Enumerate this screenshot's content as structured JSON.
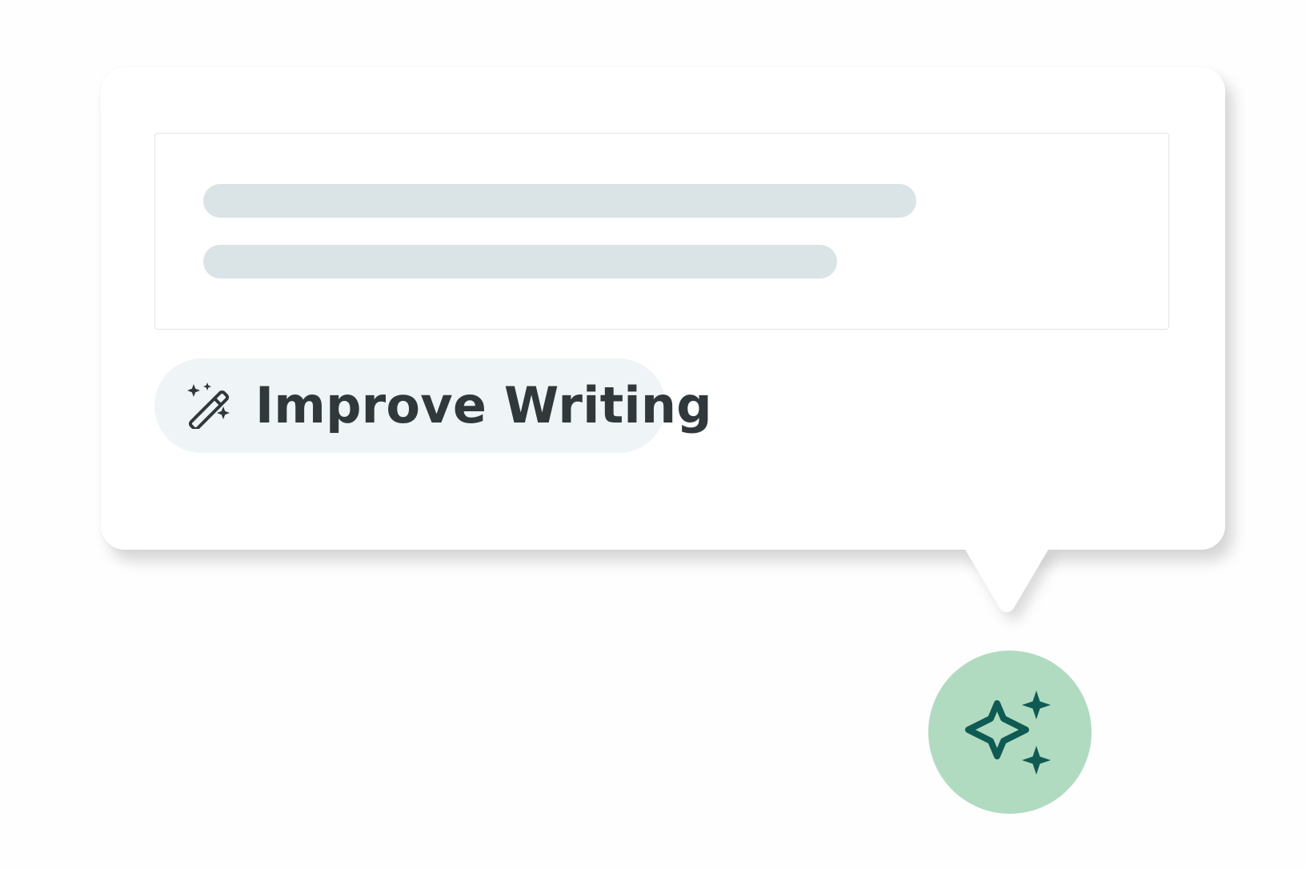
{
  "improve_writing_chip": {
    "label": "Improve Writing",
    "icon": "magic-wand-icon"
  },
  "editor": {
    "content_placeholder_lines": 2
  },
  "ai_assistant_button": {
    "icon": "sparkles-icon"
  },
  "colors": {
    "page_background": "#fefefe",
    "popover_background": "#ffffff",
    "placeholder_line": "#dae3e6",
    "chip_background": "#eff4f6",
    "chip_text": "#30383c",
    "ai_button_background": "#b1dbc1",
    "ai_icon": "#0f5a53"
  }
}
